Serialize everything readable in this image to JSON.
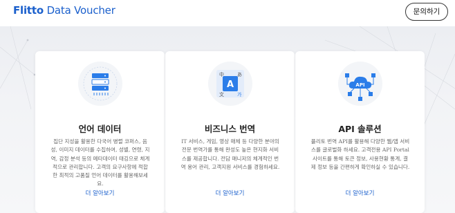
{
  "header": {
    "logo_brand": "Flitto",
    "logo_product": "Data Voucher",
    "contact_button": "문의하기"
  },
  "cards": [
    {
      "title": "언어 데이터",
      "description": "집단 지성을 활용한 다국어 병렬 코퍼스, 음\n성, 이미지 데이터를 수집하여, 성별, 연령, 지\n역, 감정 분석 등의 메타데이터 태깅으로 체계\n적으로 관리합니다. 고객의 요구사항에 적합\n한 최적의 고품질 언어 데이터를 활용해보세\n요.",
      "link": "더 알아보기",
      "icon": "server-database-icon"
    },
    {
      "title": "비즈니스 번역",
      "description": "IT 서비스, 게임, 영상 매체 등 다양한 분야의\n전문 번역가를 통해 완성도 높은 현지화 서비\n스를 제공합니다. 전담 매니저의 체계적인 번\n역 용어 관리, 고객지원 서비스를 경험하세요.",
      "link": "더 알아보기",
      "icon": "translation-icon",
      "icon_glyphs": [
        "中",
        "あ",
        "A",
        "文",
        "가"
      ]
    },
    {
      "title": "API 솔루션",
      "description": "플리토 번역 API를 활용해 다양한 웹/앱 서비\n스를 글로벌화 하세요. 고객전용 API Portal\n사이트를 통해 토큰 정보, 사용현황 통계, 결\n제 정보 등을 간편하게 확인하실 수 있습니다.",
      "link": "더 알아보기",
      "icon": "api-cloud-icon",
      "icon_label": "API"
    }
  ],
  "colors": {
    "brand_blue": "#1a5fcc",
    "icon_blue": "#2b7de9",
    "hero_bg": "#f2f3f6"
  }
}
